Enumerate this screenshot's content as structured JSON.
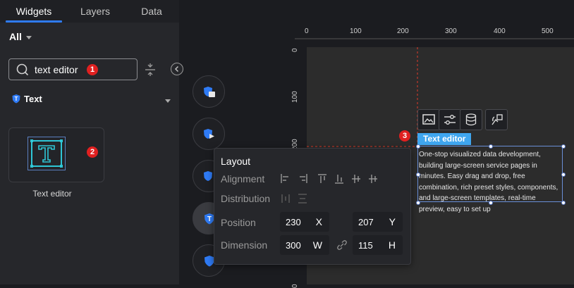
{
  "tabs": [
    {
      "label": "Widgets",
      "active": true
    },
    {
      "label": "Layers",
      "active": false
    },
    {
      "label": "Data",
      "active": false
    }
  ],
  "filter": {
    "label": "All"
  },
  "search": {
    "value": "text editor"
  },
  "category": {
    "label": "Text"
  },
  "widget": {
    "label": "Text editor"
  },
  "badges": [
    "1",
    "2",
    "3"
  ],
  "ruler_x": [
    "0",
    "100",
    "200",
    "300",
    "400",
    "500"
  ],
  "ruler_y": [
    "0",
    "100",
    "200",
    "0"
  ],
  "selected_widget": {
    "tag": "Text editor",
    "content": "One-stop visualized data development, building large-screen service pages in minutes. Easy drag and drop, free combination, rich preset styles, components, and large-screen templates, real-time preview, easy to set up"
  },
  "layout_panel": {
    "title": "Layout",
    "alignment_label": "Alignment",
    "distribution_label": "Distribution",
    "position_label": "Position",
    "dimension_label": "Dimension",
    "x": {
      "value": "230",
      "unit": "X"
    },
    "y": {
      "value": "207",
      "unit": "Y"
    },
    "w": {
      "value": "300",
      "unit": "W"
    },
    "h": {
      "value": "115",
      "unit": "H"
    }
  },
  "colors": {
    "accent": "#3fa6ef",
    "badge": "#e02020",
    "tab_underline": "#2f7bf5",
    "guide": "#e03a2a"
  }
}
